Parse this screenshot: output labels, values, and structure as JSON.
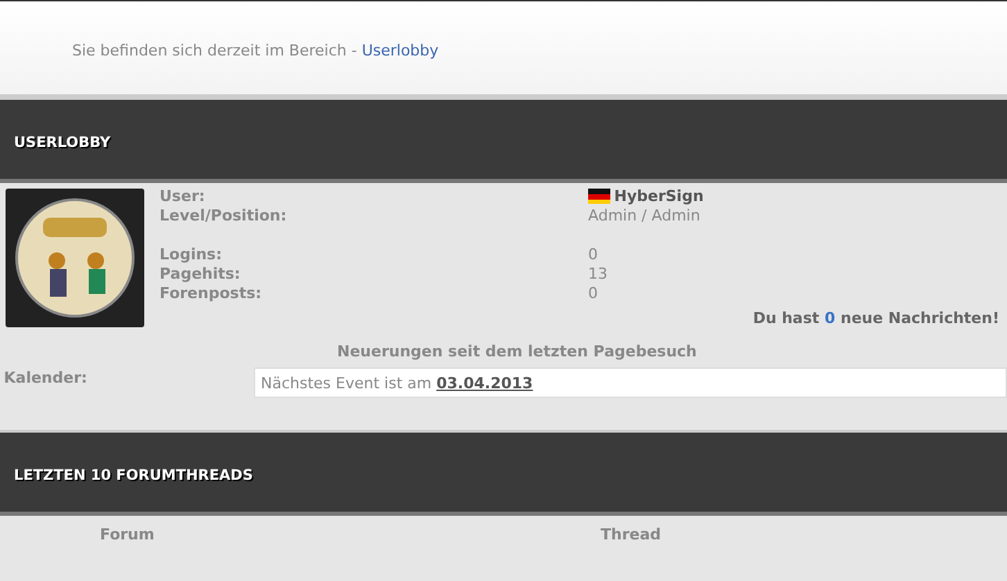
{
  "breadcrumb": {
    "text": "Sie befinden sich derzeit im Bereich -",
    "link": "Userlobby"
  },
  "userlobby": {
    "title": "USERLOBBY",
    "stats": [
      {
        "kind": "user",
        "label": "User:",
        "value": "HyberSign"
      },
      {
        "kind": "plain",
        "label": "Level/Position:",
        "value": "Admin / Admin"
      },
      {
        "kind": "spacer"
      },
      {
        "kind": "plain",
        "label": "Logins:",
        "value": "0"
      },
      {
        "kind": "plain",
        "label": "Pagehits:",
        "value": "13"
      },
      {
        "kind": "plain",
        "label": "Forenposts:",
        "value": "0"
      }
    ],
    "messages": {
      "before": "Du hast",
      "count": "0",
      "after": "neue Nachrichten!"
    },
    "news_heading": "Neuerungen seit dem letzten Pagebesuch",
    "calendar": {
      "label": "Kalender:",
      "text": "Nächstes Event ist am",
      "date": "03.04.2013"
    }
  },
  "threads": {
    "title": "LETZTEN 10 FORUMTHREADS",
    "columns": [
      "Forum",
      "Thread"
    ]
  }
}
